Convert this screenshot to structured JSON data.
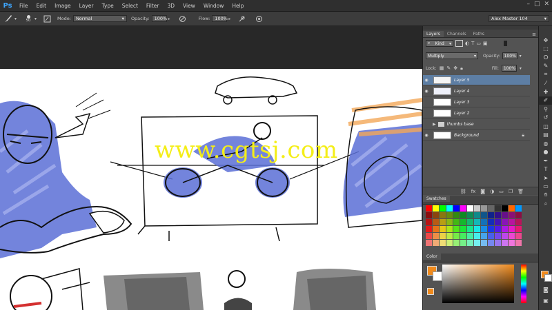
{
  "app": {
    "logo": "Ps"
  },
  "menu": [
    "File",
    "Edit",
    "Image",
    "Layer",
    "Type",
    "Select",
    "Filter",
    "3D",
    "View",
    "Window",
    "Help"
  ],
  "options": {
    "brush_size": "50",
    "mode_label": "Mode:",
    "mode_value": "Normal",
    "opacity_label": "Opacity:",
    "opacity_value": "100%",
    "flow_label": "Flow:",
    "flow_value": "100%",
    "workspace": "Alex Master 104"
  },
  "canvas": {
    "watermark": "www.cgtsj.com"
  },
  "layers_panel": {
    "tabs": [
      "Layers",
      "Channels",
      "Paths"
    ],
    "kind_filter": "Kind",
    "blend_mode": "Multiply",
    "opacity_label": "Opacity:",
    "opacity_value": "100%",
    "lock_label": "Lock:",
    "fill_label": "Fill:",
    "fill_value": "100%",
    "layers": [
      {
        "name": "Layer 5",
        "selected": true,
        "visible": true
      },
      {
        "name": "Layer 4",
        "selected": false,
        "visible": true
      },
      {
        "name": "Layer 3",
        "selected": false,
        "visible": false
      },
      {
        "name": "Layer 2",
        "selected": false,
        "visible": false
      },
      {
        "name": "thumbs base",
        "selected": false,
        "visible": false,
        "group": true
      },
      {
        "name": "Background",
        "selected": false,
        "visible": true,
        "locked": true
      }
    ]
  },
  "swatches_panel": {
    "title": "Swatches"
  },
  "color_panel": {
    "title": "Color",
    "foreground": "#f08a1c",
    "background": "#ffffff"
  },
  "colors": {
    "accent": "#3ea7ff",
    "selected_layer": "#5d7ea4",
    "sketch_blue": "#5b6fd6",
    "sketch_orange": "#f3a85a"
  }
}
